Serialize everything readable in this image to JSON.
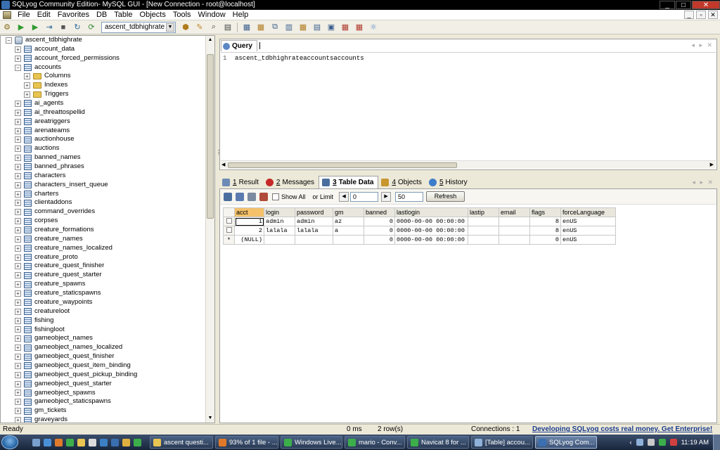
{
  "window": {
    "title": "SQLyog Community Edition- MySQL GUI - [New Connection - root@localhost]",
    "controls": {
      "minimize": "_",
      "maximize": "□",
      "close": "✕"
    }
  },
  "menu": {
    "items": [
      "File",
      "Edit",
      "Favorites",
      "DB",
      "Table",
      "Objects",
      "Tools",
      "Window",
      "Help"
    ],
    "mdi_controls": [
      "_",
      "▫",
      "✕"
    ]
  },
  "toolbar": {
    "database_selected": "ascent_tdbhighrate"
  },
  "object_browser": {
    "root": "ascent_tdbhighrate",
    "items": [
      {
        "label": "account_data",
        "depth": 1,
        "expander": "+",
        "icon": "table-icon"
      },
      {
        "label": "account_forced_permissions",
        "depth": 1,
        "expander": "+",
        "icon": "table-icon"
      },
      {
        "label": "accounts",
        "depth": 1,
        "expander": "−",
        "icon": "table-icon"
      },
      {
        "label": "Columns",
        "depth": 2,
        "expander": "+",
        "icon": "folder-icon"
      },
      {
        "label": "Indexes",
        "depth": 2,
        "expander": "+",
        "icon": "folder-icon"
      },
      {
        "label": "Triggers",
        "depth": 2,
        "expander": "+",
        "icon": "folder-icon"
      },
      {
        "label": "ai_agents",
        "depth": 1,
        "expander": "+",
        "icon": "table-icon"
      },
      {
        "label": "ai_threattospellid",
        "depth": 1,
        "expander": "+",
        "icon": "table-icon"
      },
      {
        "label": "areatriggers",
        "depth": 1,
        "expander": "+",
        "icon": "table-icon"
      },
      {
        "label": "arenateams",
        "depth": 1,
        "expander": "+",
        "icon": "table-icon"
      },
      {
        "label": "auctionhouse",
        "depth": 1,
        "expander": "+",
        "icon": "table-icon"
      },
      {
        "label": "auctions",
        "depth": 1,
        "expander": "+",
        "icon": "table-icon"
      },
      {
        "label": "banned_names",
        "depth": 1,
        "expander": "+",
        "icon": "table-icon"
      },
      {
        "label": "banned_phrases",
        "depth": 1,
        "expander": "+",
        "icon": "table-icon"
      },
      {
        "label": "characters",
        "depth": 1,
        "expander": "+",
        "icon": "table-icon"
      },
      {
        "label": "characters_insert_queue",
        "depth": 1,
        "expander": "+",
        "icon": "table-icon"
      },
      {
        "label": "charters",
        "depth": 1,
        "expander": "+",
        "icon": "table-icon"
      },
      {
        "label": "clientaddons",
        "depth": 1,
        "expander": "+",
        "icon": "table-icon"
      },
      {
        "label": "command_overrides",
        "depth": 1,
        "expander": "+",
        "icon": "table-icon"
      },
      {
        "label": "corpses",
        "depth": 1,
        "expander": "+",
        "icon": "table-icon"
      },
      {
        "label": "creature_formations",
        "depth": 1,
        "expander": "+",
        "icon": "table-icon"
      },
      {
        "label": "creature_names",
        "depth": 1,
        "expander": "+",
        "icon": "table-icon"
      },
      {
        "label": "creature_names_localized",
        "depth": 1,
        "expander": "+",
        "icon": "table-icon"
      },
      {
        "label": "creature_proto",
        "depth": 1,
        "expander": "+",
        "icon": "table-icon"
      },
      {
        "label": "creature_quest_finisher",
        "depth": 1,
        "expander": "+",
        "icon": "table-icon"
      },
      {
        "label": "creature_quest_starter",
        "depth": 1,
        "expander": "+",
        "icon": "table-icon"
      },
      {
        "label": "creature_spawns",
        "depth": 1,
        "expander": "+",
        "icon": "table-icon"
      },
      {
        "label": "creature_staticspawns",
        "depth": 1,
        "expander": "+",
        "icon": "table-icon"
      },
      {
        "label": "creature_waypoints",
        "depth": 1,
        "expander": "+",
        "icon": "table-icon"
      },
      {
        "label": "creatureloot",
        "depth": 1,
        "expander": "+",
        "icon": "table-icon"
      },
      {
        "label": "fishing",
        "depth": 1,
        "expander": "+",
        "icon": "table-icon"
      },
      {
        "label": "fishingloot",
        "depth": 1,
        "expander": "+",
        "icon": "table-icon"
      },
      {
        "label": "gameobject_names",
        "depth": 1,
        "expander": "+",
        "icon": "table-icon"
      },
      {
        "label": "gameobject_names_localized",
        "depth": 1,
        "expander": "+",
        "icon": "table-icon"
      },
      {
        "label": "gameobject_quest_finisher",
        "depth": 1,
        "expander": "+",
        "icon": "table-icon"
      },
      {
        "label": "gameobject_quest_item_binding",
        "depth": 1,
        "expander": "+",
        "icon": "table-icon"
      },
      {
        "label": "gameobject_quest_pickup_binding",
        "depth": 1,
        "expander": "+",
        "icon": "table-icon"
      },
      {
        "label": "gameobject_quest_starter",
        "depth": 1,
        "expander": "+",
        "icon": "table-icon"
      },
      {
        "label": "gameobject_spawns",
        "depth": 1,
        "expander": "+",
        "icon": "table-icon"
      },
      {
        "label": "gameobject_staticspawns",
        "depth": 1,
        "expander": "+",
        "icon": "table-icon"
      },
      {
        "label": "gm_tickets",
        "depth": 1,
        "expander": "+",
        "icon": "table-icon"
      },
      {
        "label": "graveyards",
        "depth": 1,
        "expander": "+",
        "icon": "table-icon"
      }
    ]
  },
  "query": {
    "tab_label": "Query",
    "line_number": "1",
    "text": "ascent_tdbhighrateaccountsaccounts"
  },
  "result_tabs": [
    {
      "num": "1",
      "label": "Result",
      "icon": "result-icon",
      "active": false
    },
    {
      "num": "2",
      "label": "Messages",
      "icon": "error-icon",
      "active": false
    },
    {
      "num": "3",
      "label": "Table Data",
      "icon": "table-data-icon",
      "active": true
    },
    {
      "num": "4",
      "label": "Objects",
      "icon": "objects-icon",
      "active": false
    },
    {
      "num": "5",
      "label": "History",
      "icon": "history-icon",
      "active": false
    }
  ],
  "data_toolbar": {
    "show_all_label": "Show All",
    "or_limit_label": "or Limit",
    "offset_value": "0",
    "limit_value": "50",
    "refresh_label": "Refresh"
  },
  "grid": {
    "columns": [
      "acct",
      "login",
      "password",
      "gm",
      "banned",
      "lastlogin",
      "lastip",
      "email",
      "flags",
      "forceLanguage"
    ],
    "rows": [
      {
        "marker": "",
        "cells": [
          "1",
          "admin",
          "admin",
          "az",
          "0",
          "0000-00-00 00:00:00",
          "",
          "",
          "8",
          "enUS"
        ]
      },
      {
        "marker": "",
        "cells": [
          "2",
          "lalala",
          "lalala",
          "a",
          "0",
          "0000-00-00 00:00:00",
          "",
          "",
          "8",
          "enUS"
        ]
      },
      {
        "marker": "*",
        "cells": [
          "(NULL)",
          "",
          "",
          "",
          "0",
          "0000-00-00 00:00:00",
          "",
          "",
          "0",
          "enUS"
        ]
      }
    ]
  },
  "status": {
    "ready": "Ready",
    "time": "0 ms",
    "rows": "2 row(s)",
    "connections": "Connections : 1",
    "promo": "Developing SQLyog costs real money. Get Enterprise!"
  },
  "taskbar": {
    "tasks": [
      {
        "label": "ascent questi...",
        "active": false
      },
      {
        "label": "93% of 1 file - ...",
        "active": false
      },
      {
        "label": "Windows Live...",
        "active": false
      },
      {
        "label": "mario - Conv...",
        "active": false
      },
      {
        "label": "Navicat 8 for ...",
        "active": false
      },
      {
        "label": "[Table] accou...",
        "active": false
      },
      {
        "label": "SQLyog Com...",
        "active": true
      }
    ],
    "clock": "11:19 AM"
  },
  "colors": {
    "accent": "#f5c26b",
    "promo": "#1c3d8f"
  }
}
